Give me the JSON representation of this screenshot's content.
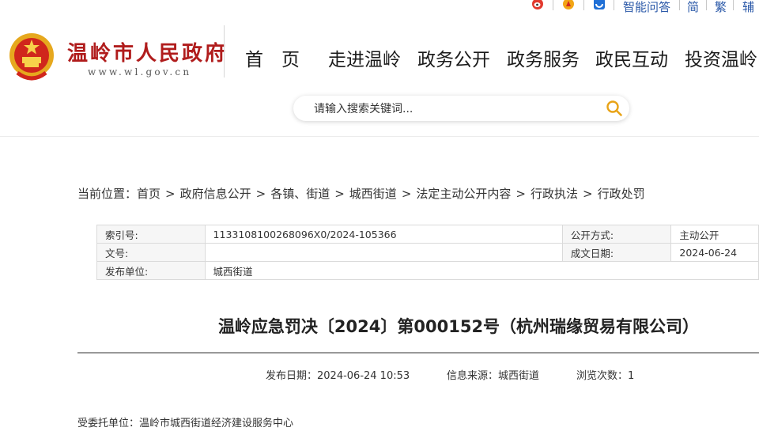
{
  "topbar": {
    "qa_label": "智能问答",
    "simplified_label": "简",
    "traditional_label": "繁",
    "assist_label": "辅"
  },
  "header": {
    "site_name": "温岭市人民政府",
    "site_url": "www.wl.gov.cn"
  },
  "nav": {
    "items": [
      "首　页",
      "走进温岭",
      "政务公开",
      "政务服务",
      "政民互动",
      "投资温岭"
    ]
  },
  "search": {
    "placeholder": "请输入搜索关键词..."
  },
  "breadcrumb": {
    "prefix": "当前位置：",
    "items": [
      "首页",
      "政府信息公开",
      "各镇、街道",
      "城西街道",
      "法定主动公开内容",
      "行政执法",
      "行政处罚"
    ],
    "separator": ">"
  },
  "info_table": {
    "index_label": "索引号:",
    "index_value": "1133108100268096X0/2024-105366",
    "method_label": "公开方式:",
    "method_value": "主动公开",
    "docno_label": "文号:",
    "docno_value": "",
    "date_label": "成文日期:",
    "date_value": "2024-06-24",
    "publisher_label": "发布单位:",
    "publisher_value": "城西街道"
  },
  "document": {
    "title": "温岭应急罚决〔2024〕第000152号（杭州瑞缘贸易有限公司）",
    "publish_date": "发布日期：2024-06-24 10:53",
    "source": "信息来源：城西街道",
    "views": "浏览次数：1",
    "body_line": "受委托单位：温岭市城西街道经济建设服务中心"
  },
  "colors": {
    "brand_red": "#b01c1c",
    "link_blue": "#2a58a8",
    "search_icon": "#e8a317"
  }
}
